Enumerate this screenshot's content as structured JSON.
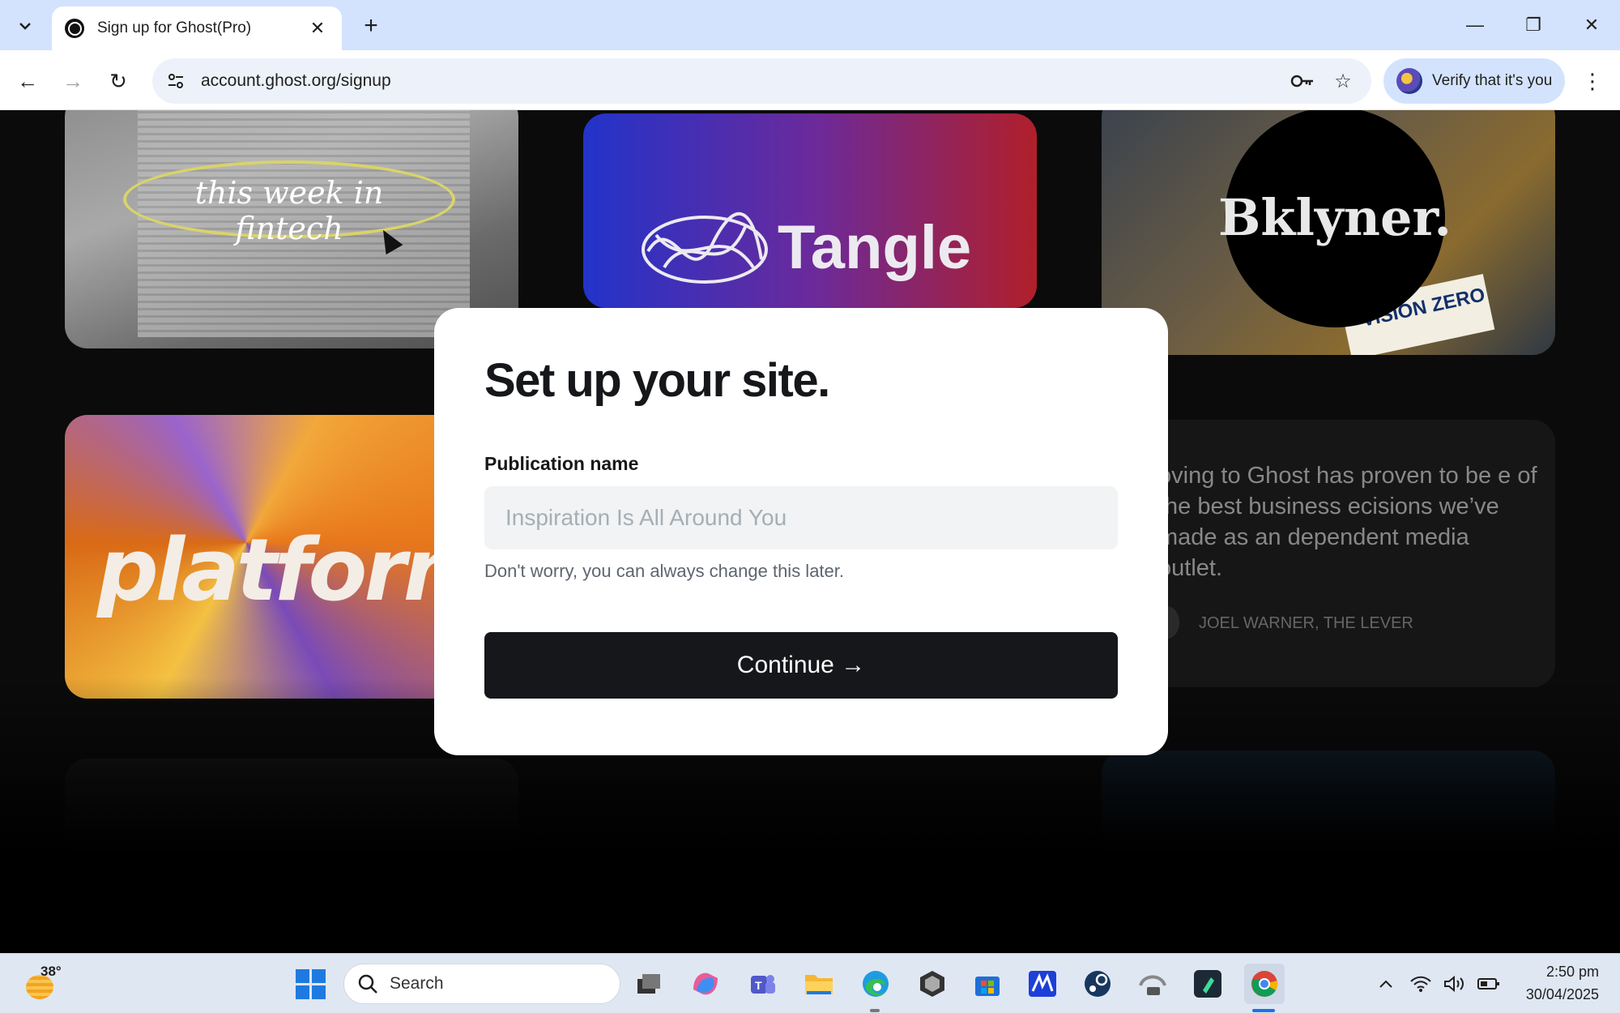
{
  "browser": {
    "tab_title": "Sign up for Ghost(Pro)",
    "url": "account.ghost.org/signup",
    "verify_label": "Verify that it's you",
    "tab_close": "✕",
    "new_tab": "+",
    "minimize": "—",
    "restore": "❐",
    "close": "✕",
    "back": "←",
    "forward": "→",
    "reload": "↻",
    "menu": "⋮"
  },
  "background_cards": {
    "fintech_text": "this week in fintech",
    "tangle_text": "Tangle",
    "bklyner_text": "Bklyner.",
    "bklyner_sign": "VISION ZERO",
    "platformer_text": "platforme",
    "quote_text": "oving to Ghost has proven to be e of the best business ecisions we’ve made as an dependent media outlet.",
    "quote_author": "JOEL WARNER, THE LEVER"
  },
  "modal": {
    "title": "Set up your site.",
    "field_label": "Publication name",
    "field_value": "",
    "field_placeholder": "Inspiration Is All Around You",
    "hint": "Don't worry, you can always change this later.",
    "continue_label": "Continue →"
  },
  "taskbar": {
    "temperature": "38°",
    "search_label": "Search",
    "time": "2:50 pm",
    "date": "30/04/2025"
  },
  "icons": [
    "tab-search-icon",
    "ghost-favicon-icon",
    "back-icon",
    "forward-icon",
    "reload-icon",
    "site-info-icon",
    "password-key-icon",
    "bookmark-star-icon",
    "profile-avatar-icon",
    "menu-icon",
    "weather-icon",
    "windows-start-icon",
    "search-icon",
    "task-view-icon",
    "copilot-icon",
    "teams-icon",
    "file-explorer-icon",
    "edge-icon",
    "app-icon",
    "microsoft-store-icon",
    "app-m-icon",
    "steam-icon",
    "app-pro-icon",
    "app-green-icon",
    "chrome-icon",
    "tray-chevron-icon",
    "wifi-icon",
    "volume-icon",
    "battery-icon"
  ],
  "colors": {
    "tab_strip": "#d3e3fd",
    "modal_button": "#15171a",
    "accent_chrome": "#1a73e8"
  }
}
